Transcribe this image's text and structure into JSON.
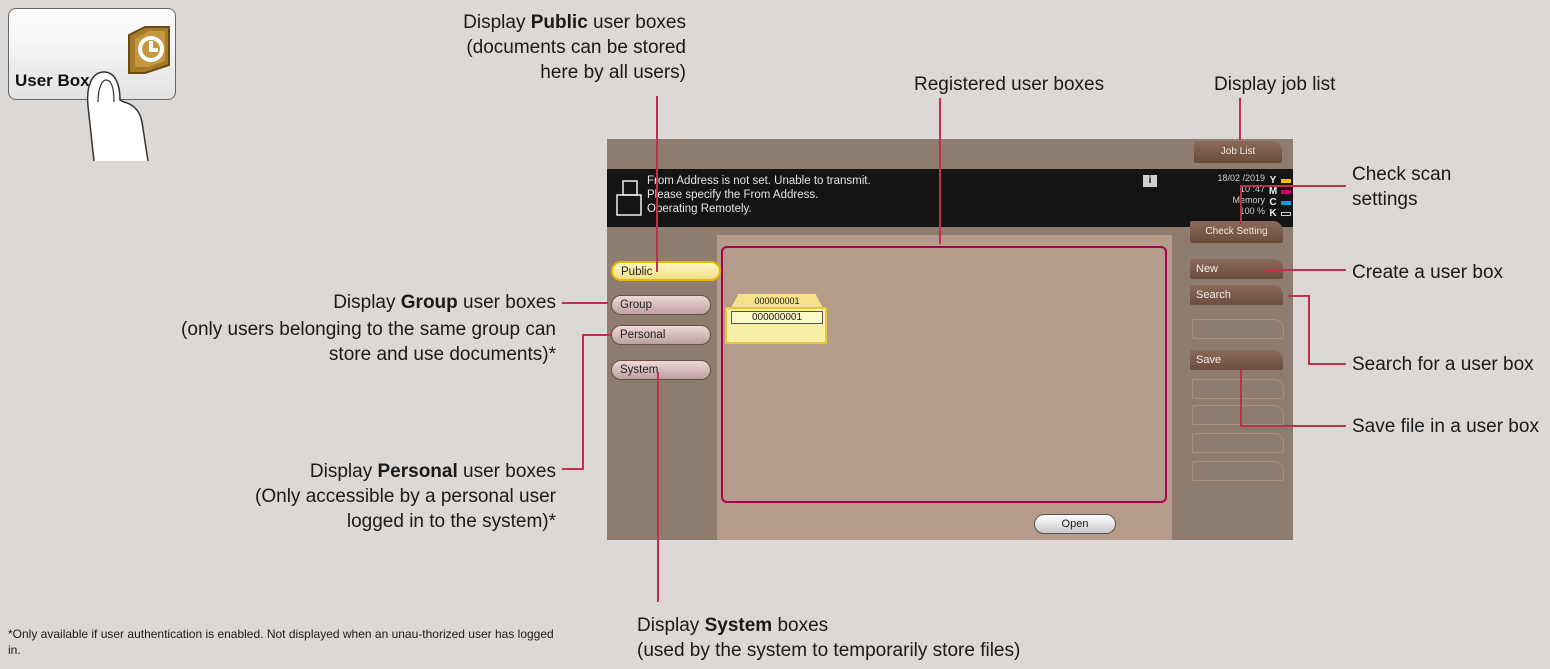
{
  "key": {
    "label": "User Box",
    "icon": "user-box-icon"
  },
  "screen": {
    "job_list": "Job List",
    "message": [
      "From Address is not set. Unable to transmit.",
      "Please specify the From Address.",
      "Operating Remotely."
    ],
    "date": "18/02 /2019",
    "time": "10 :47",
    "memory_label": "Memory",
    "memory_value": "100 %",
    "toner_labels": [
      "Y",
      "M",
      "C",
      "K"
    ],
    "toner_colors": [
      "#f2c400",
      "#d0006f",
      "#009ee0",
      "#333333"
    ],
    "check_setting": "Check Setting",
    "tabs": [
      "Public",
      "Group",
      "Personal",
      "System"
    ],
    "active_tab": "Public",
    "side_buttons": [
      "New",
      "Search",
      "Save"
    ],
    "box": {
      "tab_number": "000000001",
      "name": "000000001"
    },
    "open": "Open"
  },
  "annotations": {
    "public_pre": "Display ",
    "public_bold": "Public",
    "public_post": " user boxes",
    "public_line2": "(documents can be stored",
    "public_line3": "here by all users)",
    "registered": "Registered user boxes",
    "job_list": "Display job list",
    "check_scan_1": "Check scan",
    "check_scan_2": "settings",
    "create": "Create a user box",
    "search": "Search for a user box",
    "save": "Save file in a user box",
    "group_pre": "Display ",
    "group_bold": "Group",
    "group_post": " user boxes",
    "group_line2": "(only users belonging to the same group can",
    "group_line3": "store and use documents)*",
    "personal_pre": "Display ",
    "personal_bold": "Personal",
    "personal_post": " user boxes",
    "personal_line2": "(Only accessible by a personal user",
    "personal_line3": "logged in to the system)*",
    "system_pre": "Display ",
    "system_bold": "System",
    "system_post": " boxes",
    "system_line2": "(used by the system to temporarily store files)",
    "footnote": "*Only available if user authentication is enabled. Not displayed when an unau-thorized user has logged in."
  }
}
